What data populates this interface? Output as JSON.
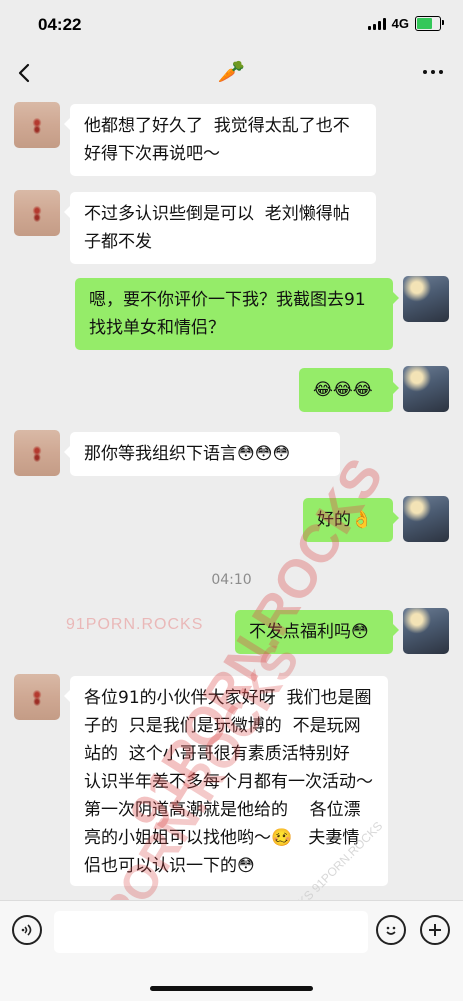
{
  "status_bar": {
    "time": "04:22",
    "network": "4G"
  },
  "nav": {
    "title": "🥕"
  },
  "messages": [
    {
      "text": "他都想了好久了  我觉得太乱了也不好得下次再说吧～"
    },
    {
      "text": "不过多认识些倒是可以  老刘懒得帖子都不发"
    },
    {
      "text": "嗯，要不你评价一下我？我截图去91找找单女和情侣？"
    },
    {
      "text": "😂😂😂"
    },
    {
      "text": "那你等我组织下语言😳😳😳"
    },
    {
      "text": "好的👌"
    },
    {
      "text": "不发点福利吗😳"
    },
    {
      "text": "各位91的小伙伴大家好呀  我们也是圈子的  只是我们是玩微博的  不是玩网站的  这个小哥哥很有素质活特别好  认识半年差不多每个月都有一次活动～  第一次阴道高潮就是他给的    各位漂亮的小姐姐可以找他哟～🥴   夫妻情侣也可以认识一下的😳"
    }
  ],
  "time_divider": "04:10",
  "watermarks": {
    "small": "91PORN.ROCKS",
    "big_top": "91PORN.ROCKS",
    "big_mid": "91PORN.ROCKS",
    "diag": "91PORN.ROCKS 91PORN.ROCKS"
  },
  "colors": {
    "bubble_out": "#95ec69",
    "bubble_in": "#ffffff",
    "background": "#ededed"
  },
  "icons": {
    "back": "chevron-left-icon",
    "more": "more-dots-icon",
    "voice": "voice-icon",
    "emoji": "emoji-icon",
    "plus": "plus-icon"
  }
}
